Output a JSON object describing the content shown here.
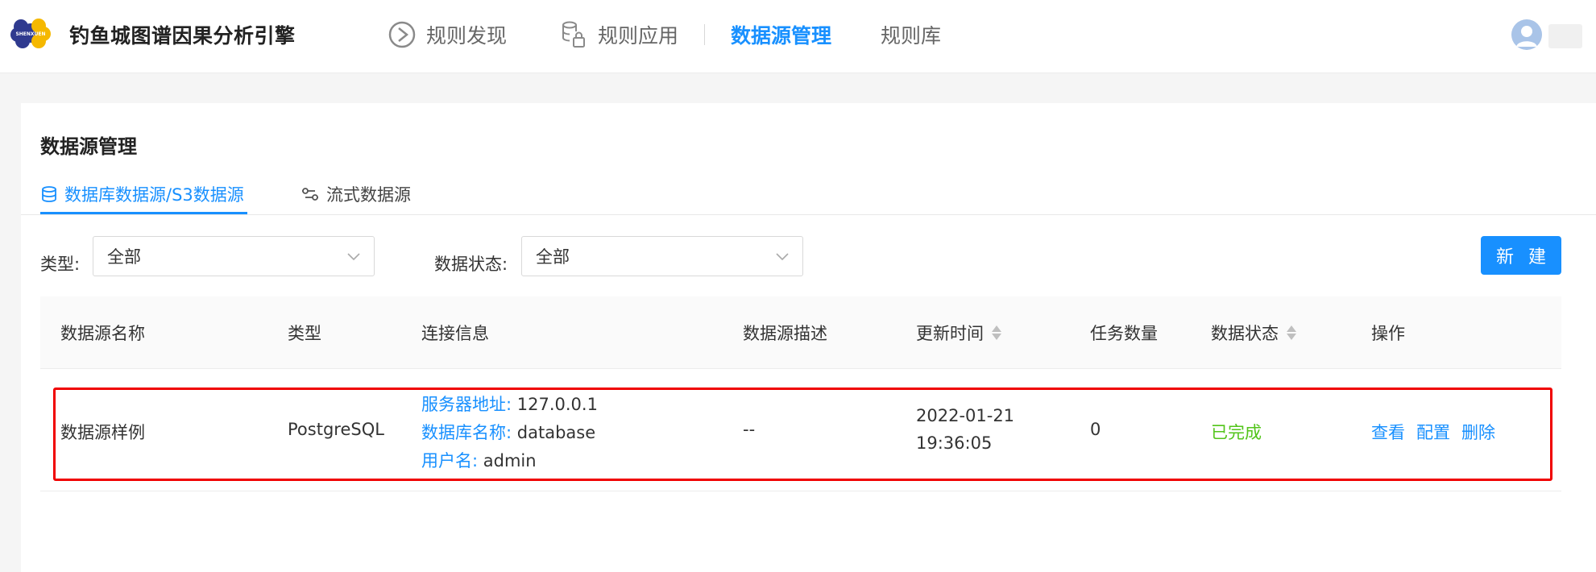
{
  "app": {
    "title": "钓鱼城图谱因果分析引擎",
    "logo_text": "SHENXUEN"
  },
  "nav": {
    "items": [
      {
        "label": "规则发现",
        "icon": "discover-icon"
      },
      {
        "label": "规则应用",
        "icon": "database-lock-icon"
      },
      {
        "label": "数据源管理",
        "icon": "",
        "active": true
      },
      {
        "label": "规则库",
        "icon": ""
      }
    ]
  },
  "colors": {
    "accent": "#1890ff",
    "success": "#52c41a",
    "highlight": "#f00000"
  },
  "page": {
    "title": "数据源管理"
  },
  "tabs": [
    {
      "label": "数据库数据源/S3数据源",
      "icon": "database-icon",
      "active": true
    },
    {
      "label": "流式数据源",
      "icon": "stream-icon",
      "active": false
    }
  ],
  "filters": {
    "type": {
      "label": "类型:",
      "value": "全部"
    },
    "status": {
      "label": "数据状态:",
      "value": "全部"
    }
  },
  "buttons": {
    "new": "新 建"
  },
  "table": {
    "columns": [
      "数据源名称",
      "类型",
      "连接信息",
      "数据源描述",
      "更新时间",
      "任务数量",
      "数据状态",
      "操作"
    ],
    "rows": [
      {
        "name": "数据源样例",
        "type": "PostgreSQL",
        "connection": [
          {
            "key": "服务器地址:",
            "value": "127.0.0.1"
          },
          {
            "key": "数据库名称:",
            "value": "database"
          },
          {
            "key": "用户名:",
            "value": "admin"
          }
        ],
        "description": "--",
        "updated_date": "2022-01-21",
        "updated_time": "19:36:05",
        "task_count": "0",
        "status": "已完成",
        "actions": [
          "查看",
          "配置",
          "删除"
        ]
      }
    ]
  }
}
